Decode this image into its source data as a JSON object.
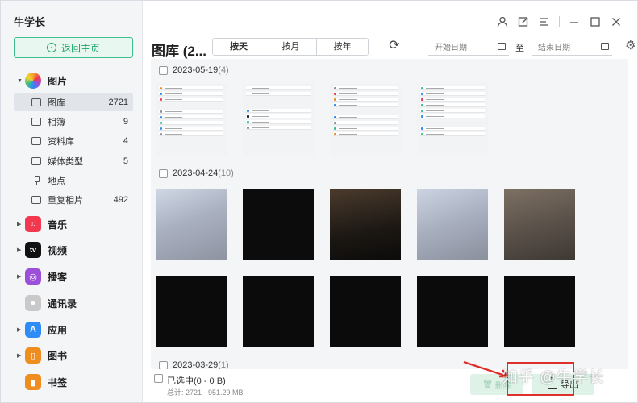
{
  "app": {
    "title": "牛学长"
  },
  "sidebar": {
    "home_label": "返回主页",
    "categories": [
      {
        "label": "图片",
        "icon": "photos-icon",
        "color": "#f4a62a"
      },
      {
        "label": "音乐",
        "icon": "music-icon",
        "color": "#f2384e"
      },
      {
        "label": "视频",
        "icon": "appletv-icon",
        "color": "#111111",
        "icon_text": "tv"
      },
      {
        "label": "播客",
        "icon": "podcast-icon",
        "color": "#9c4fd8"
      },
      {
        "label": "通讯录",
        "icon": "contacts-icon",
        "color": "#b9b9b9"
      },
      {
        "label": "应用",
        "icon": "appstore-icon",
        "color": "#2f8bf5"
      },
      {
        "label": "图书",
        "icon": "books-icon",
        "color": "#f08d1f"
      },
      {
        "label": "书签",
        "icon": "bookmark-icon",
        "color": "#f08d1f"
      }
    ],
    "photo_subitems": [
      {
        "label": "图库",
        "count": "2721"
      },
      {
        "label": "相簿",
        "count": "9"
      },
      {
        "label": "资料库",
        "count": "4"
      },
      {
        "label": "媒体类型",
        "count": "5"
      },
      {
        "label": "地点",
        "count": ""
      },
      {
        "label": "重复相片",
        "count": "492"
      }
    ]
  },
  "toolbar": {
    "title": "图库 (2...",
    "tabs": [
      "按天",
      "按月",
      "按年"
    ],
    "active_tab": "按天",
    "start_date_placeholder": "开始日期",
    "to_label": "至",
    "end_date_placeholder": "结束日期"
  },
  "groups": [
    {
      "date": "2023-05-19",
      "count": "(4)"
    },
    {
      "date": "2023-04-24",
      "count": "(10)"
    },
    {
      "date": "2023-03-29",
      "count": "(1)"
    }
  ],
  "footer": {
    "selected": "已选中(0 - 0 B)",
    "total": "总计: 2721 - 951.29 MB",
    "delete_label": "删除",
    "export_label": "导出"
  },
  "watermark": "知乎 @牛学长",
  "colors": {
    "accent": "#1ea56a",
    "accent_bg": "#e8f7ef",
    "highlight": "#e0302b"
  }
}
